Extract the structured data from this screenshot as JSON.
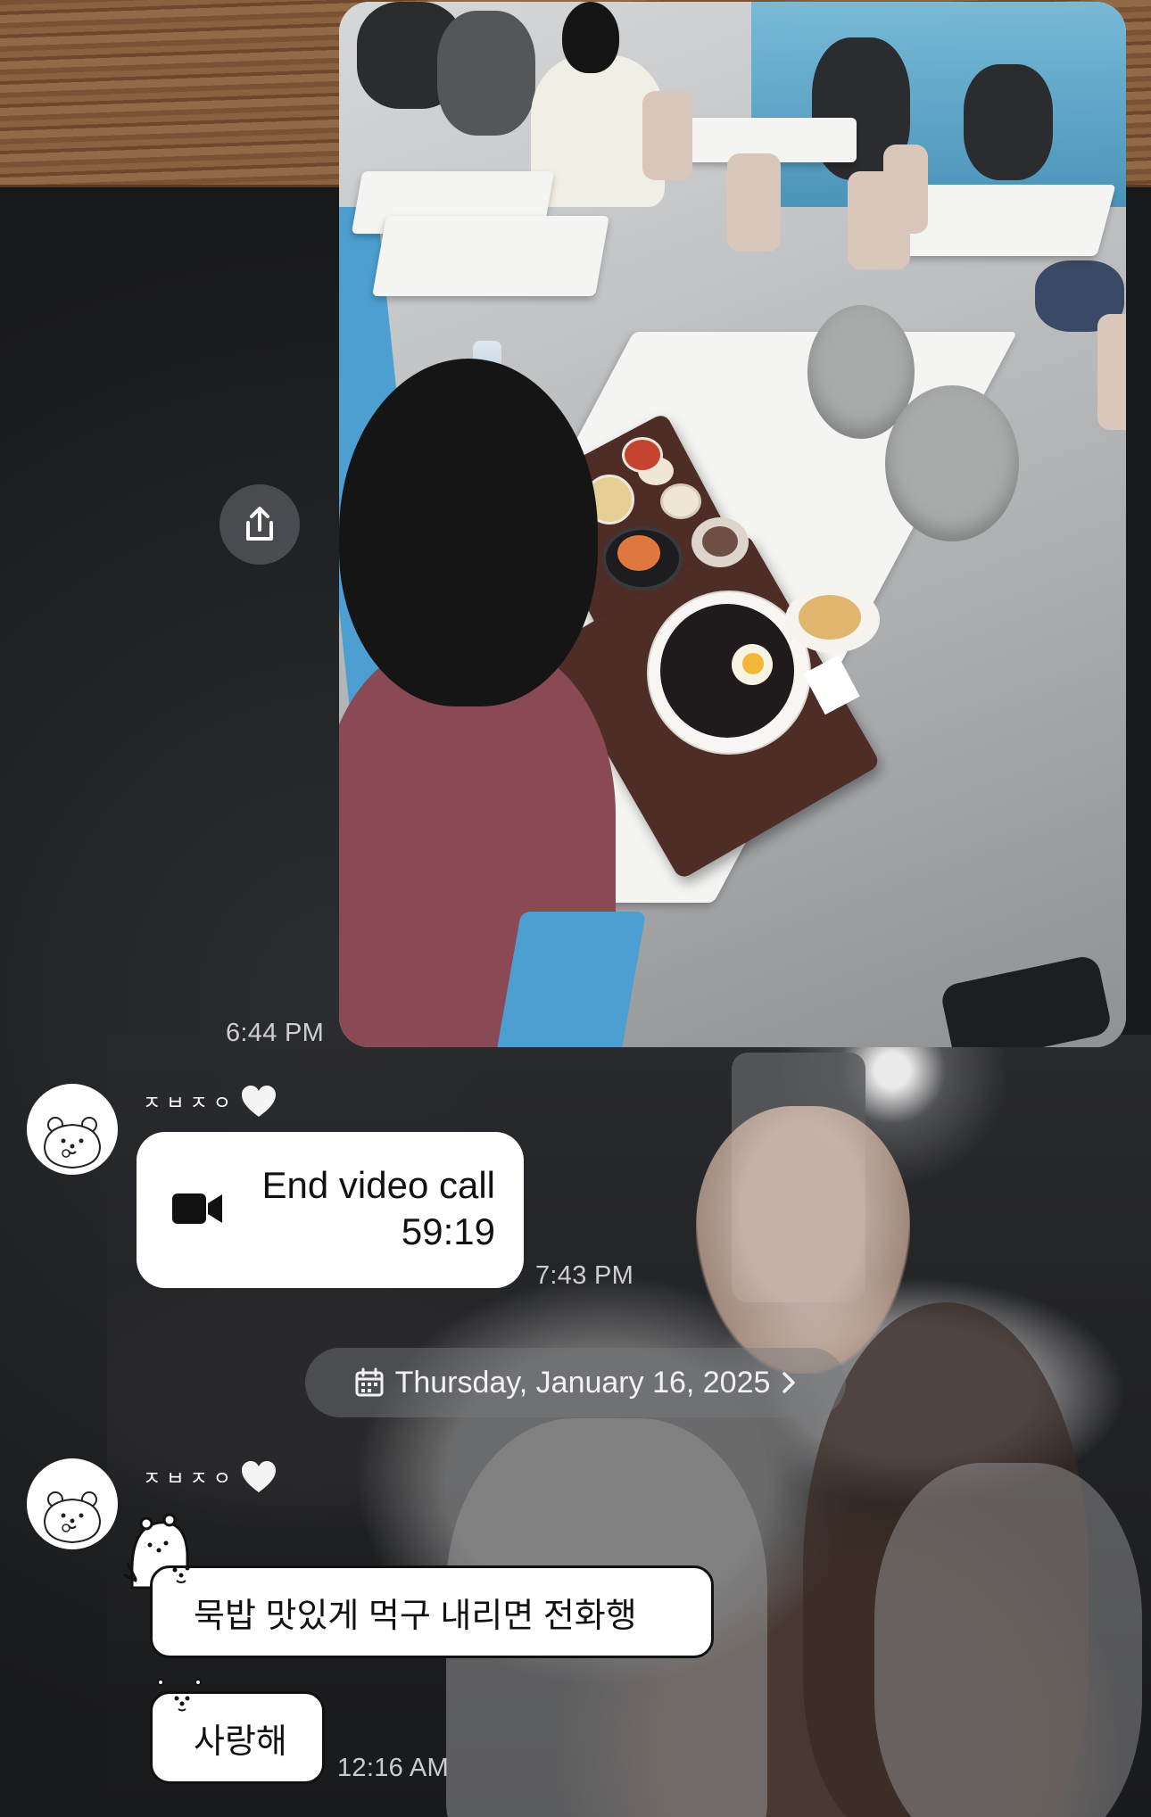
{
  "messages": {
    "photo_time": "6:44 PM",
    "sender_name": "ㅈㅂㅈㅇ",
    "call": {
      "title": "End video call",
      "duration": "59:19",
      "time": "7:43 PM"
    },
    "date_separator": "Thursday, January 16, 2025",
    "text_1": "묵밥 맛있게 먹구 내리면 전화행",
    "text_2": "사랑해",
    "last_time": "12:16 AM"
  },
  "icons": {
    "share": "share-upload-icon",
    "video": "video-camera-icon",
    "calendar": "calendar-icon",
    "chevron": "chevron-right-icon",
    "heart": "white-heart-icon",
    "avatar": "bear-avatar-icon"
  }
}
